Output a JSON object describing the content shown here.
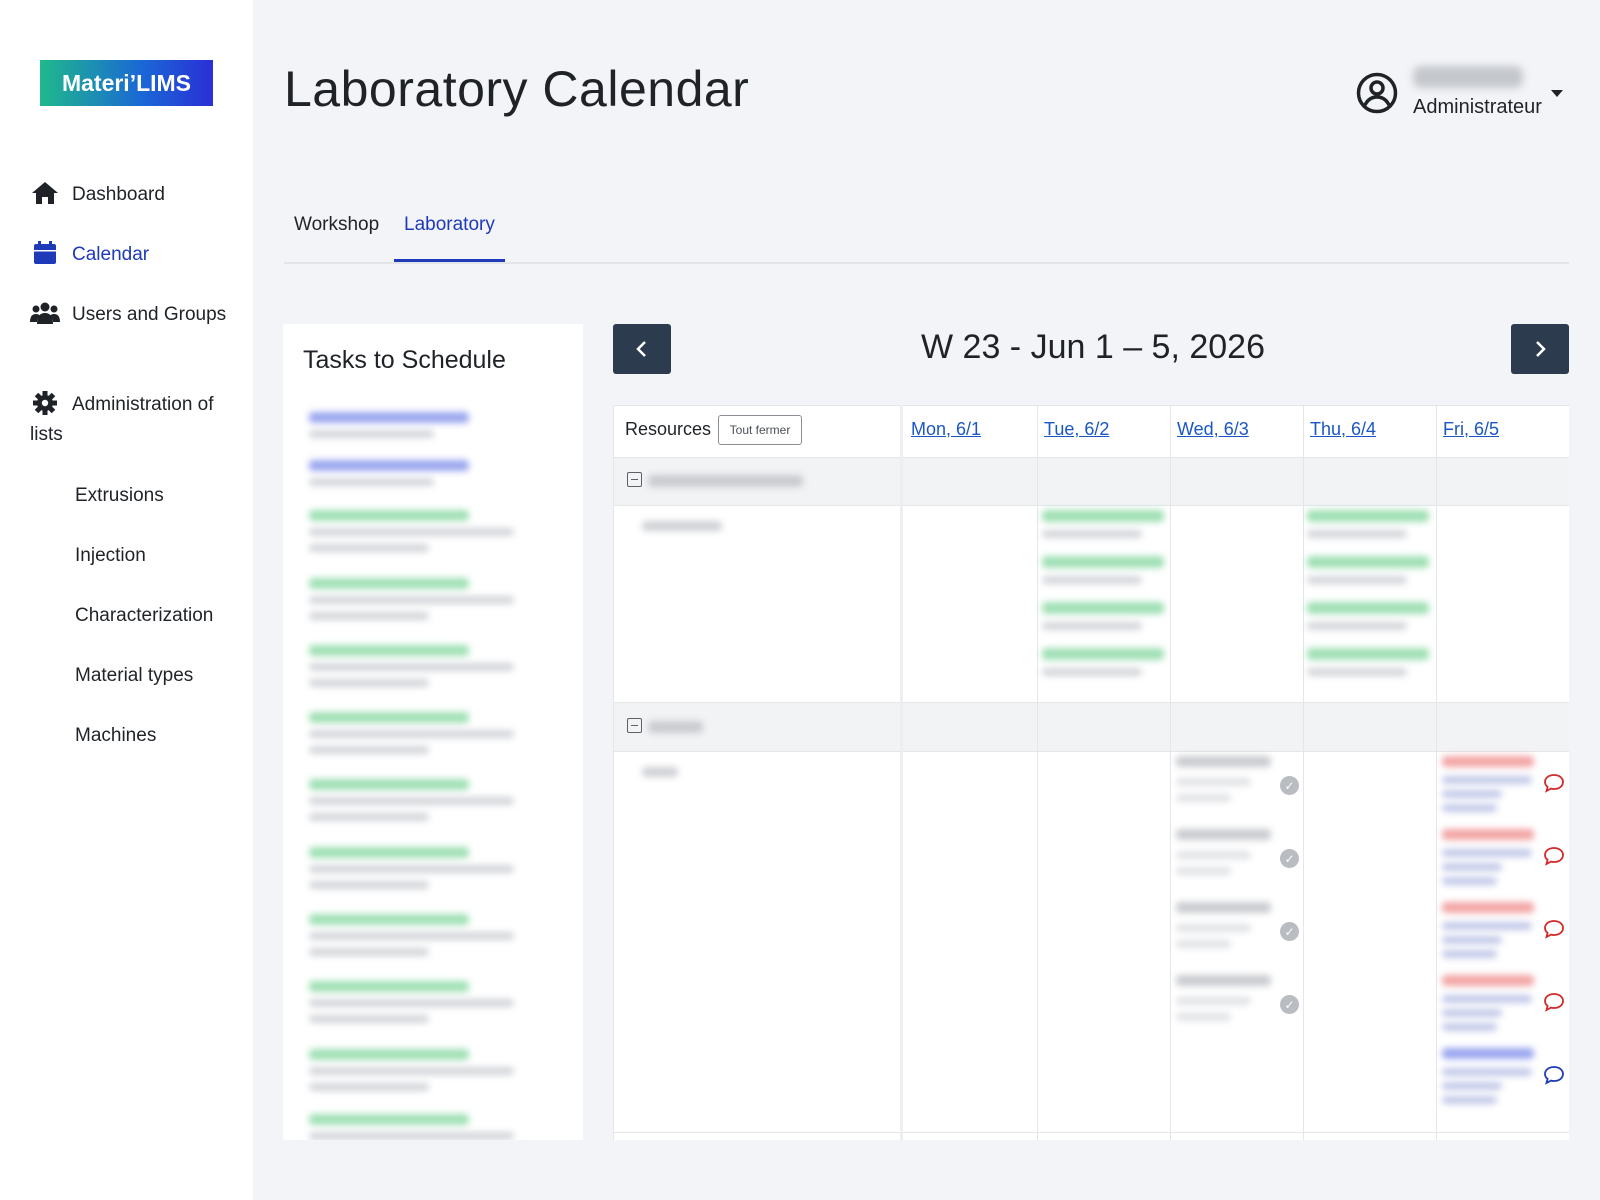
{
  "app": {
    "logo_text": "Materi’LIMS",
    "page_title": "Laboratory Calendar"
  },
  "sidebar": {
    "items": [
      {
        "label": "Dashboard",
        "icon": "home-icon",
        "active": false
      },
      {
        "label": "Calendar",
        "icon": "calendar-icon",
        "active": true
      },
      {
        "label": "Users and Groups",
        "icon": "users-icon",
        "active": false
      },
      {
        "label": "Administration of lists",
        "icon": "gear-icon",
        "active": false
      }
    ],
    "subitems": [
      "Extrusions",
      "Injection",
      "Characterization",
      "Material types",
      "Machines"
    ]
  },
  "user": {
    "role": "Administrateur"
  },
  "tabs": [
    {
      "label": "Workshop",
      "active": false
    },
    {
      "label": "Laboratory",
      "active": true
    }
  ],
  "tasks": {
    "title": "Tasks to Schedule"
  },
  "calendar": {
    "title": "W 23 - Jun 1 – 5, 2026",
    "resources_label": "Resources",
    "collapse_all_label": "Tout fermer",
    "days": [
      "Mon, 6/1",
      "Tue, 6/2",
      "Wed, 6/3",
      "Thu, 6/4",
      "Fri, 6/5"
    ]
  },
  "colors": {
    "accent": "#1f3ab8",
    "link": "#1b57c4",
    "nav_button": "#2c3b4e",
    "event_green": "#9fe0b4",
    "event_blue": "#9aa6ef",
    "event_red": "#f2a4a4",
    "event_gray": "#c9cbcf",
    "comment_red": "#d12a2a",
    "comment_blue": "#1f3ab8"
  }
}
